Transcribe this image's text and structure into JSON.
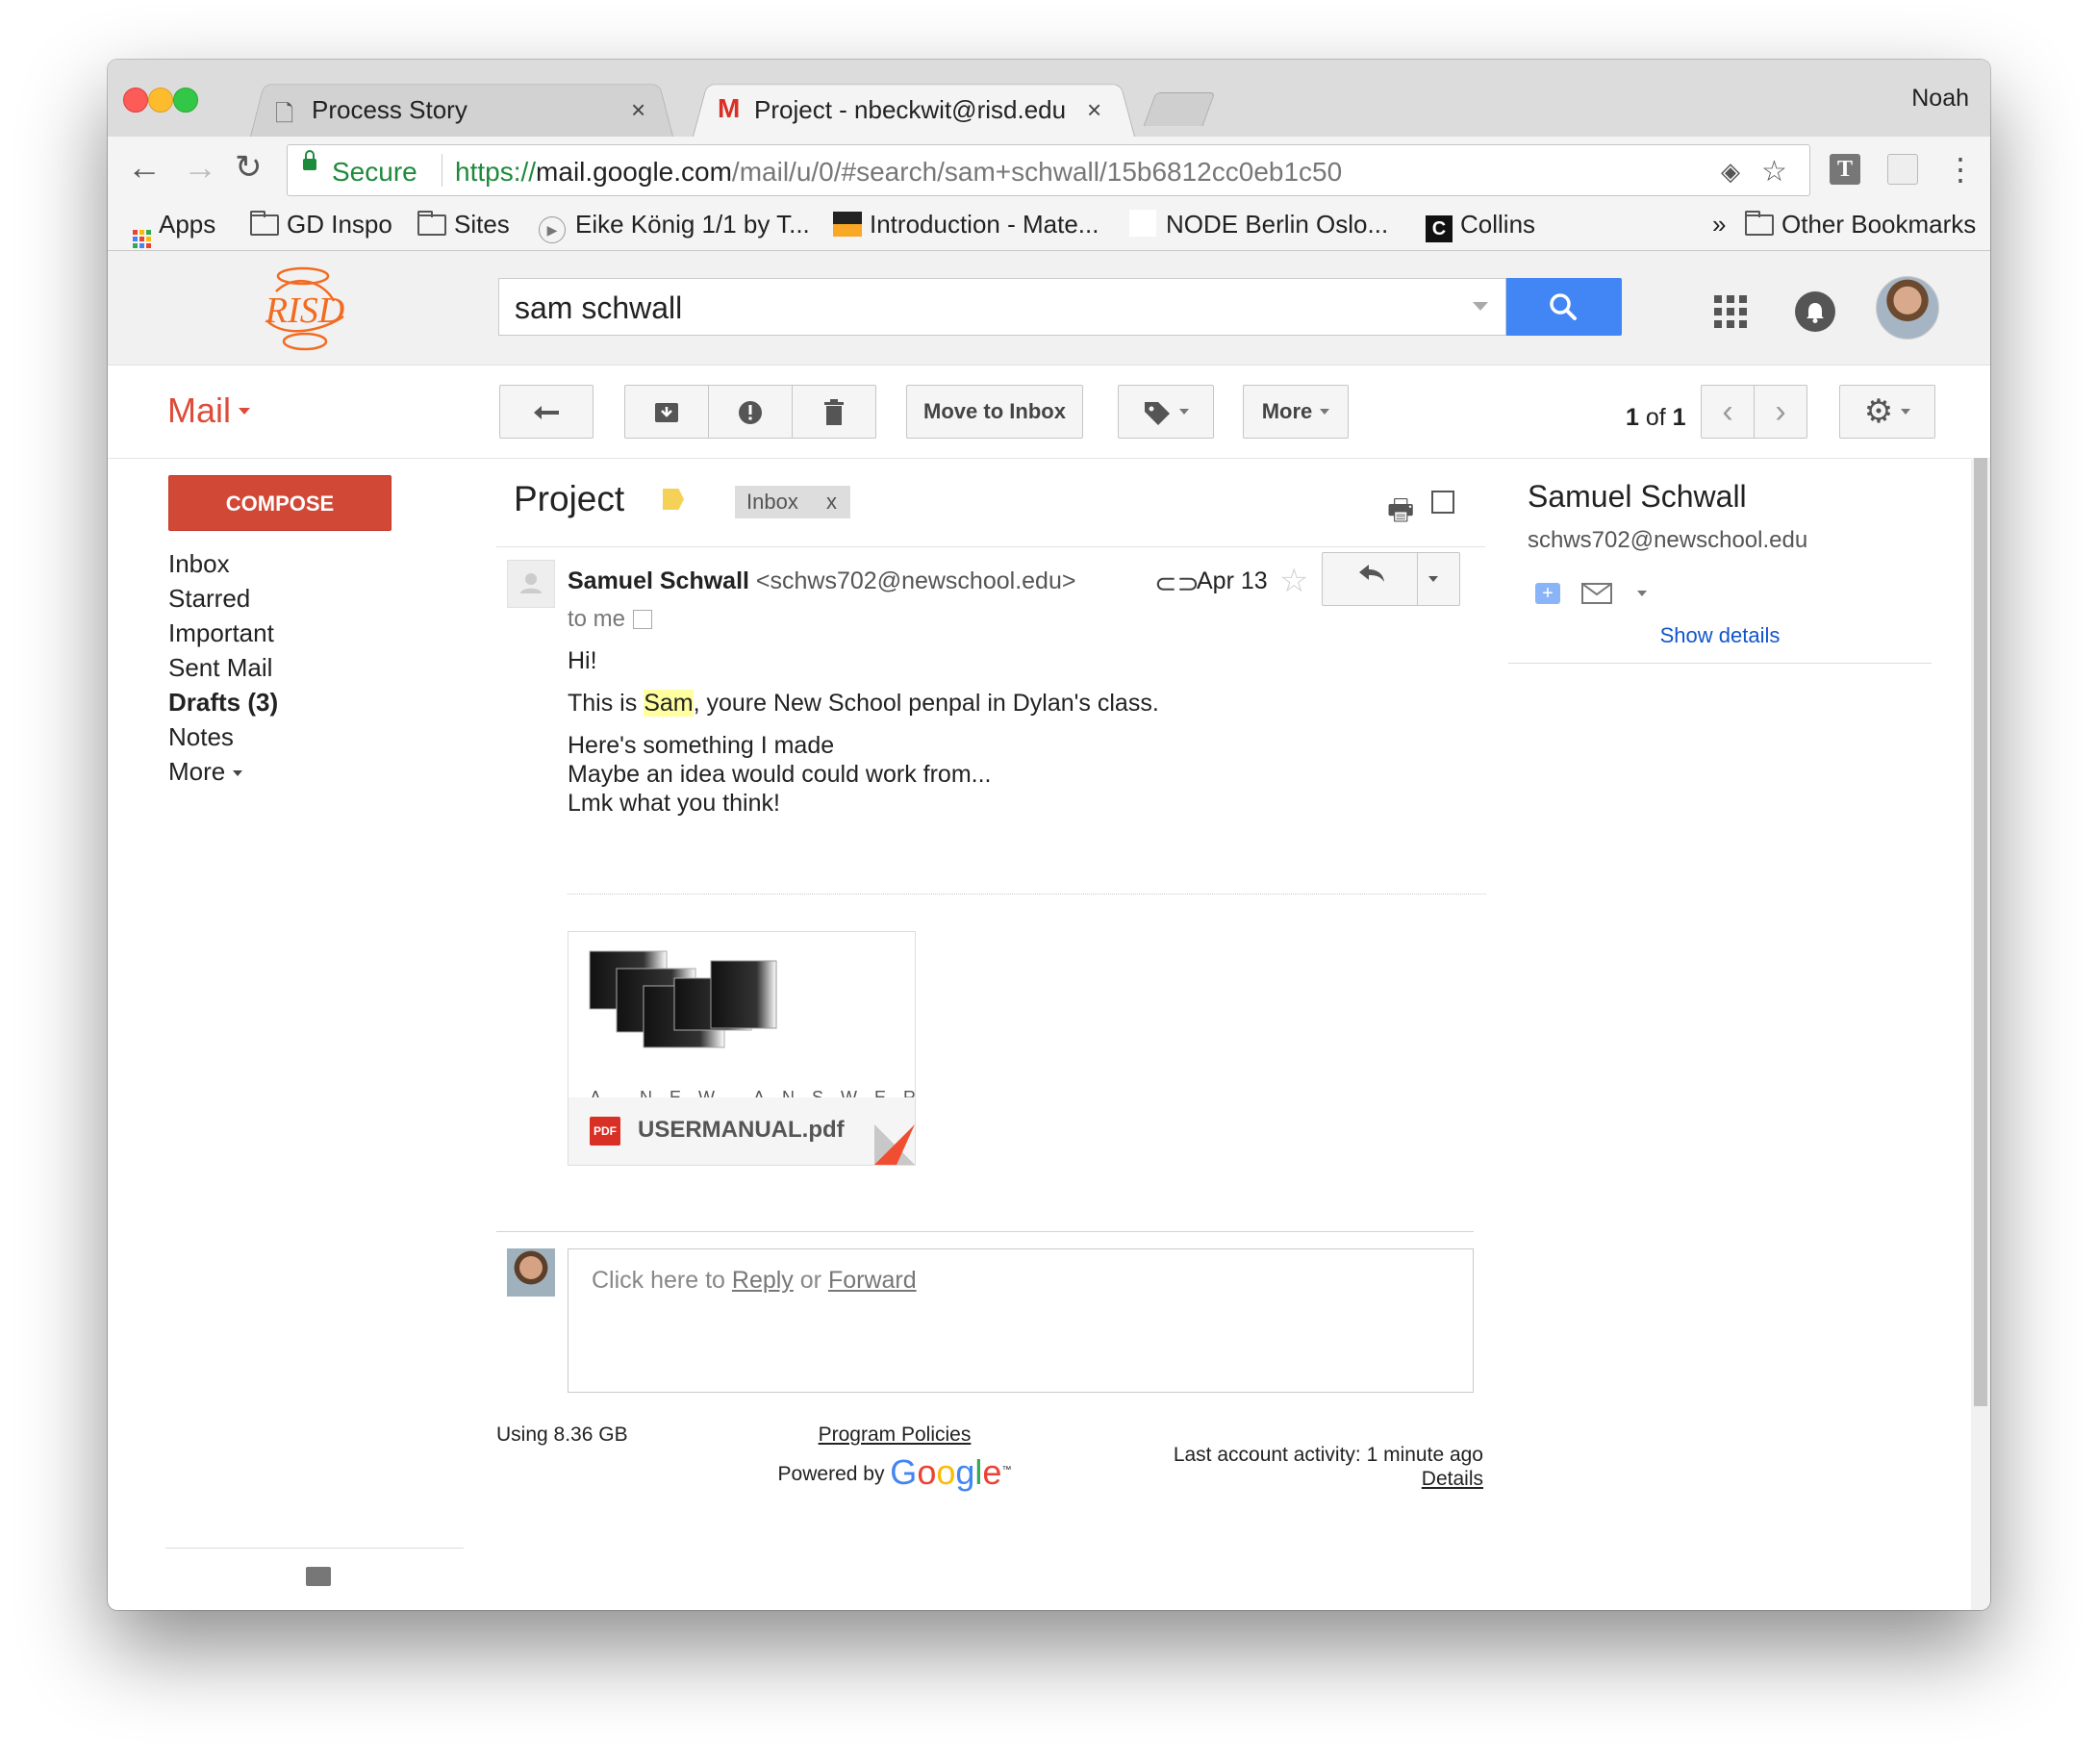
{
  "browser": {
    "profile": "Noah",
    "tabs": [
      {
        "title": "Process Story",
        "close": "×"
      },
      {
        "title": "Project - nbeckwit@risd.edu -",
        "close": "×"
      }
    ],
    "address": {
      "secure_label": "Secure",
      "url_scheme": "https://",
      "url_host": "mail.google.com",
      "url_path": "/mail/u/0/#search/sam+schwall/15b6812cc0eb1c50"
    },
    "bookmarks": [
      {
        "label": "Apps"
      },
      {
        "label": "GD Inspo"
      },
      {
        "label": "Sites"
      },
      {
        "label": "Eike König 1/1 by T..."
      },
      {
        "label": "Introduction - Mate..."
      },
      {
        "label": "NODE Berlin Oslo..."
      },
      {
        "label": "Collins"
      }
    ],
    "overflow": "»",
    "other_bookmarks": "Other Bookmarks",
    "collins_badge": "C"
  },
  "gmail": {
    "logo_text": "RISD",
    "search_value": "sam schwall",
    "mail_label": "Mail",
    "compose_label": "COMPOSE",
    "nav": [
      "Inbox",
      "Starred",
      "Important",
      "Sent Mail",
      "Drafts (3)",
      "Notes",
      "More"
    ],
    "move_to_inbox": "Move to Inbox",
    "more_label": "More",
    "counter_current": "1",
    "counter_of": "of",
    "counter_total": "1"
  },
  "thread": {
    "subject": "Project",
    "label_chip": "Inbox",
    "label_chip_close": "x",
    "sender_name": "Samuel Schwall",
    "sender_email": "<schws702@newschool.edu>",
    "to": "to me",
    "date": "Apr 13",
    "body": {
      "greeting": "Hi!",
      "line1_pre": "This is ",
      "line1_highlight": "Sam",
      "line1_post": ", youre New School penpal in Dylan's class.",
      "line2": "Here's something I made",
      "line3": "Maybe an idea would could work from...",
      "line4": "Lmk what you think!"
    },
    "attachment": {
      "badge": "PDF",
      "filename": "USERMANUAL.pdf",
      "preview_caption": "A NEW ANSWER"
    },
    "reply_prompt_pre": "Click here to ",
    "reply_link": "Reply",
    "reply_or": " or ",
    "forward_link": "Forward"
  },
  "footer": {
    "storage": "Using 8.36 GB",
    "policies": "Program Policies",
    "powered_by": "Powered by",
    "google": "Google",
    "tm": "™",
    "activity": "Last account activity: 1 minute ago",
    "details": "Details"
  },
  "contact_panel": {
    "name": "Samuel Schwall",
    "email": "schws702@newschool.edu",
    "show_details": "Show details"
  },
  "colors": {
    "compose": "#d14836",
    "search_button": "#4285f4",
    "secure_green": "#1e8a3c",
    "mail_red": "#dd4b39",
    "link_blue": "#1155cc",
    "risd_orange": "#f26b21"
  }
}
